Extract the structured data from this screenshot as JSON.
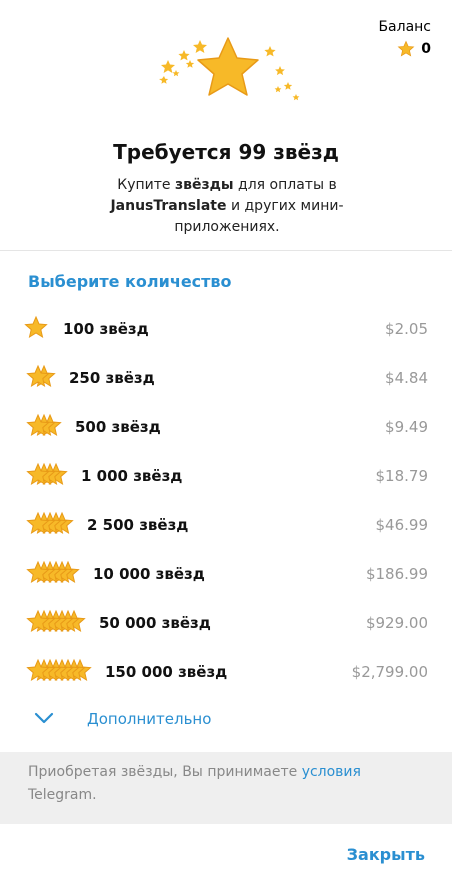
{
  "balance": {
    "label": "Баланс",
    "value": "0"
  },
  "header": {
    "title": "Требуется 99 звёзд",
    "subtitle_prefix": "Купите ",
    "subtitle_bold1": "звёзды",
    "subtitle_mid": " для оплаты в ",
    "subtitle_bold2": "JanusTranslate",
    "subtitle_suffix": " и других мини-приложениях."
  },
  "section_title": "Выберите количество",
  "options": [
    {
      "amount": "100 звёзд",
      "price": "$2.05"
    },
    {
      "amount": "250 звёзд",
      "price": "$4.84"
    },
    {
      "amount": "500 звёзд",
      "price": "$9.49"
    },
    {
      "amount": "1 000 звёзд",
      "price": "$18.79"
    },
    {
      "amount": "2 500 звёзд",
      "price": "$46.99"
    },
    {
      "amount": "10 000 звёзд",
      "price": "$186.99"
    },
    {
      "amount": "50 000 звёзд",
      "price": "$929.00"
    },
    {
      "amount": "150 000 звёзд",
      "price": "$2,799.00"
    }
  ],
  "more_label": "Дополнительно",
  "footer": {
    "text": "Приобретая звёзды, Вы принимаете ",
    "link": "условия",
    "text_after": " Telegram."
  },
  "close_label": "Закрыть",
  "colors": {
    "accent": "#2a8fd1",
    "star": "#f7b928",
    "star_dark": "#e89a17"
  },
  "icons": [
    "star-icon",
    "chevron-down-icon"
  ]
}
